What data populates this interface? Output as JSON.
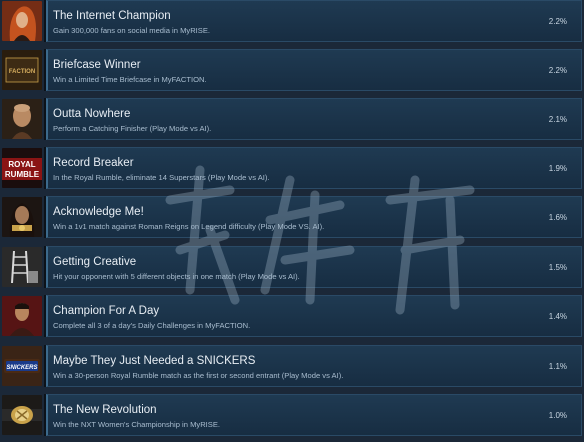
{
  "achievements": [
    {
      "title": "The Internet Champion",
      "description": "Gain 300,000 fans on social media in MyRISE.",
      "percent": "2.2%",
      "icon": "wrestler-red-hair-portrait"
    },
    {
      "title": "Briefcase Winner",
      "description": "Win a Limited Time Briefcase in MyFACTION.",
      "percent": "2.2%",
      "icon": "faction-briefcase-logo"
    },
    {
      "title": "Outta Nowhere",
      "description": "Perform a Catching Finisher (Play Mode vs AI).",
      "percent": "2.1%",
      "icon": "bald-wrestler-portrait"
    },
    {
      "title": "Record Breaker",
      "description": "In the Royal Rumble, eliminate 14 Superstars (Play Mode vs AI).",
      "percent": "1.9%",
      "icon": "royal-rumble-logo"
    },
    {
      "title": "Acknowledge Me!",
      "description": "Win a 1v1 match against Roman Reigns on Legend difficulty (Play Mode VS. AI).",
      "percent": "1.6%",
      "icon": "roman-reigns-portrait"
    },
    {
      "title": "Getting Creative",
      "description": "Hit your opponent with 5 different objects in one match (Play Mode vs AI).",
      "percent": "1.5%",
      "icon": "ladder-objects-icon"
    },
    {
      "title": "Champion For A Day",
      "description": "Complete all 3 of a day's Daily Challenges in MyFACTION.",
      "percent": "1.4%",
      "icon": "champion-portrait"
    },
    {
      "title": "Maybe They Just Needed a SNICKERS",
      "description": "Win a 30-person Royal Rumble match as the first or second entrant (Play Mode vs AI).",
      "percent": "1.1%",
      "icon": "snickers-logo"
    },
    {
      "title": "The New Revolution",
      "description": "Win the NXT Women's Championship in MyRISE.",
      "percent": "1.0%",
      "icon": "championship-belt-icon"
    }
  ],
  "icon_labels": {
    "faction": "FACTION",
    "royal_1": "ROYAL",
    "royal_2": "RUMBLE",
    "snickers": "SNICKERS"
  },
  "colors": {
    "page_background": "#1b2838",
    "row_panel": "#1f3a52",
    "title_text": "#e8eef4",
    "description_text": "#a9bdcf",
    "percent_text": "#c9d6e2"
  }
}
